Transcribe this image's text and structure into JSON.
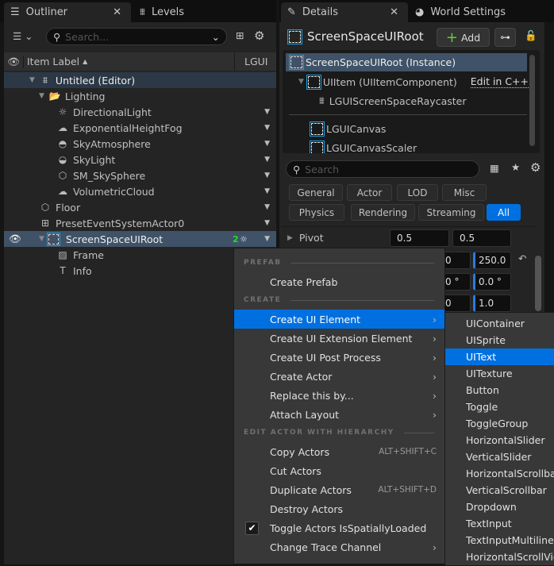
{
  "outliner": {
    "tab_label": "Outliner",
    "levels_tab": "Levels",
    "search_placeholder": "Search...",
    "header_label": "Item Label",
    "header_col": "LGUI",
    "rows": [
      {
        "label": "Untitled (Editor)",
        "icon": "level-icon"
      },
      {
        "label": "Lighting",
        "icon": "folder-icon"
      },
      {
        "label": "DirectionalLight",
        "icon": "directional-light-icon"
      },
      {
        "label": "ExponentialHeightFog",
        "icon": "fog-icon"
      },
      {
        "label": "SkyAtmosphere",
        "icon": "sky-atmosphere-icon"
      },
      {
        "label": "SkyLight",
        "icon": "sky-light-icon"
      },
      {
        "label": "SM_SkySphere",
        "icon": "static-mesh-icon"
      },
      {
        "label": "VolumetricCloud",
        "icon": "cloud-icon"
      },
      {
        "label": "Floor",
        "icon": "static-mesh-icon"
      },
      {
        "label": "PresetEventSystemActor0",
        "icon": "event-system-icon"
      },
      {
        "label": "ScreenSpaceUIRoot",
        "icon": "ui-item-icon",
        "badge": "2"
      },
      {
        "label": "Frame",
        "icon": "image-icon"
      },
      {
        "label": "Info",
        "icon": "text-icon"
      }
    ]
  },
  "details": {
    "tab_label": "Details",
    "world_settings_tab": "World Settings",
    "title": "ScreenSpaceUIRoot",
    "add_label": "Add",
    "components": [
      {
        "label": "ScreenSpaceUIRoot (Instance)"
      },
      {
        "label": "UIItem (UIItemComponent)",
        "link": "Edit in C++"
      },
      {
        "label": "LGUIScreenSpaceRaycaster"
      },
      {
        "label": "LGUICanvas"
      },
      {
        "label": "LGUICanvasScaler"
      }
    ],
    "search_placeholder": "Search",
    "filters_row1": [
      "General",
      "Actor",
      "LOD",
      "Misc"
    ],
    "filters_row2": [
      "Physics",
      "Rendering",
      "Streaming",
      "All"
    ],
    "active_filter": "All",
    "pivot_label": "Pivot",
    "pivot_x": "0.5",
    "pivot_y": "0.5",
    "values": [
      [
        "0",
        "250.0"
      ],
      [
        "0 °",
        "0.0 °"
      ],
      [
        "0",
        "1.0"
      ]
    ]
  },
  "context_menu": {
    "section_prefab": "PREFAB",
    "create_prefab": "Create Prefab",
    "section_create": "CREATE",
    "create_items": [
      "Create UI Element",
      "Create UI Extension Element",
      "Create UI Post Process",
      "Create Actor",
      "Replace this by...",
      "Attach Layout"
    ],
    "section_edit": "EDIT ACTOR WITH HIERARCHY",
    "edit_items": [
      {
        "label": "Copy Actors",
        "shortcut": "ALT+SHIFT+C"
      },
      {
        "label": "Cut Actors",
        "shortcut": ""
      },
      {
        "label": "Duplicate Actors",
        "shortcut": "ALT+SHIFT+D"
      },
      {
        "label": "Destroy Actors",
        "shortcut": ""
      },
      {
        "label": "Toggle Actors IsSpatiallyLoaded",
        "shortcut": "",
        "checked": true
      },
      {
        "label": "Change Trace Channel",
        "shortcut": ""
      }
    ]
  },
  "submenu": {
    "items": [
      "UIContainer",
      "UISprite",
      "UIText",
      "UITexture",
      "Button",
      "Toggle",
      "ToggleGroup",
      "HorizontalSlider",
      "VerticalSlider",
      "HorizontalScrollbar",
      "VerticalScrollbar",
      "Dropdown",
      "TextInput",
      "TextInputMultiline",
      "HorizontalScrollView"
    ],
    "highlighted": "UIText"
  },
  "colors": {
    "accent": "#0070e0",
    "selection": "#3f5267",
    "badge": "#22dd22"
  }
}
